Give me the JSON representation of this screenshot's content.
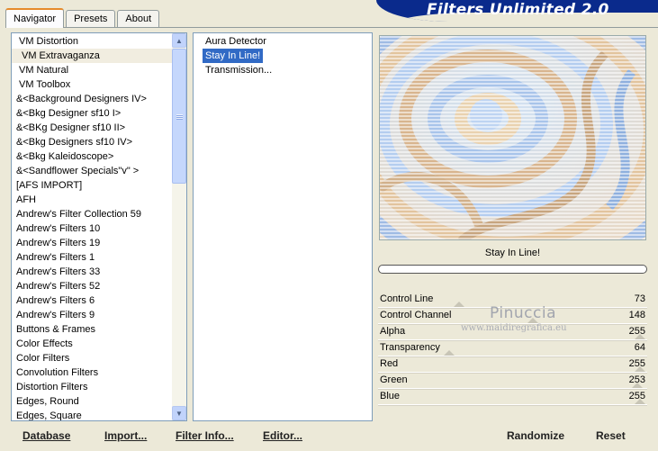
{
  "tabs": [
    "Navigator",
    "Presets",
    "About"
  ],
  "banner_title": "Filters Unlimited 2.0",
  "categories": [
    "VM Distortion",
    "VM Extravaganza",
    "VM Natural",
    "VM Toolbox",
    "&<Background Designers IV>",
    "&<Bkg Designer sf10 I>",
    "&<BKg Designer sf10 II>",
    "&<Bkg Designers sf10 IV>",
    "&<Bkg Kaleidoscope>",
    "&<Sandflower Specials\"v\" >",
    "[AFS IMPORT]",
    "AFH",
    "Andrew's Filter Collection 59",
    "Andrew's Filters 10",
    "Andrew's Filters 19",
    "Andrew's Filters 1",
    "Andrew's Filters 33",
    "Andrew's Filters 52",
    "Andrew's Filters 6",
    "Andrew's Filters 9",
    "Buttons & Frames",
    "Color Effects",
    "Color Filters",
    "Convolution Filters",
    "Distortion Filters",
    "Edges, Round",
    "Edges, Square"
  ],
  "selected_category": "VM Extravaganza",
  "filters": [
    "Aura Detector",
    "Stay In Line!",
    "Transmission..."
  ],
  "selected_filter": "Stay In Line!",
  "preview_caption": "Stay In Line!",
  "params": [
    {
      "label": "Control Line",
      "value": "73",
      "level": 0.29
    },
    {
      "label": "Control Channel",
      "value": "148",
      "level": 0.58
    },
    {
      "label": "Alpha",
      "value": "255",
      "level": 1.0
    },
    {
      "label": "Transparency",
      "value": "64",
      "level": 0.25
    },
    {
      "label": "Red",
      "value": "255",
      "level": 1.0
    },
    {
      "label": "Green",
      "value": "253",
      "level": 0.99
    },
    {
      "label": "Blue",
      "value": "255",
      "level": 1.0
    }
  ],
  "watermark": {
    "name": "Pinuccia",
    "site": "www.maidiregrafica.eu"
  },
  "bottom_left": {
    "database": "Database",
    "import": "Import...",
    "filter_info": "Filter Info...",
    "editor": "Editor..."
  },
  "bottom_right": {
    "randomize": "Randomize",
    "reset": "Reset"
  },
  "colors": {
    "selection": "#316ac5",
    "banner": "#0a2a8c",
    "face": "#ece9d8"
  }
}
